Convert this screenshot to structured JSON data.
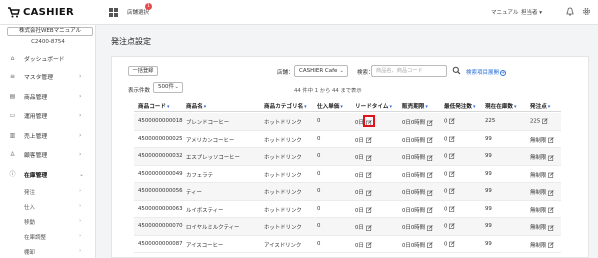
{
  "app": {
    "logo_text": "CASHIER",
    "brand_color": "#111111"
  },
  "header": {
    "store_switch_label": "店舗選択",
    "store_switch_badge": "1",
    "manual_label": "マニュアル",
    "user_label": "担当者",
    "user_chevron": "▾"
  },
  "sidebar": {
    "store_name": "株式会社WEBマニュアル",
    "store_code": "C2400-8754",
    "items": [
      {
        "label": "ダッシュボード",
        "icon": "home-icon"
      },
      {
        "label": "マスタ管理",
        "icon": "database-icon"
      },
      {
        "label": "商品管理",
        "icon": "box-icon"
      },
      {
        "label": "運用管理",
        "icon": "doc-icon"
      },
      {
        "label": "売上管理",
        "icon": "chart-icon"
      },
      {
        "label": "顧客管理",
        "icon": "person-icon"
      },
      {
        "label": "在庫管理",
        "icon": "info-icon"
      }
    ],
    "sub_items": [
      {
        "label": "発注"
      },
      {
        "label": "仕入"
      },
      {
        "label": "移動"
      },
      {
        "label": "在庫調整"
      },
      {
        "label": "棚卸"
      }
    ]
  },
  "main": {
    "title": "発注点設定",
    "add_button": "一括登録",
    "shop_label": "店舗：",
    "shop_value": "CASHIER Cafe",
    "keyword_label": "検索：",
    "keyword_placeholder": "商品名、商品コード",
    "advanced_search": "検索項目展開",
    "per_page_label": "表示件数",
    "per_page_value": "500件",
    "count_text": "44 件中 1 から 44 まで表示"
  },
  "table": {
    "headers": [
      "商品コード",
      "商品名",
      "商品カテゴリ名",
      "仕入単価",
      "リードタイム",
      "販売期限",
      "最低発注数",
      "現在在庫数",
      "発注点"
    ],
    "rows": [
      {
        "code": "4500000000018",
        "name": "ブレンドコーヒー",
        "category": "ホットドリンク",
        "cost": "0",
        "lead": "0日",
        "limit": "0日0時間",
        "min": "0",
        "stock": "225",
        "point": "225"
      },
      {
        "code": "4500000000025",
        "name": "アメリカンコーヒー",
        "category": "ホットドリンク",
        "cost": "0",
        "lead": "0日",
        "limit": "0日0時間",
        "min": "0",
        "stock": "99",
        "point": "無制限"
      },
      {
        "code": "4500000000032",
        "name": "エスプレッソコーヒー",
        "category": "ホットドリンク",
        "cost": "0",
        "lead": "0日",
        "limit": "0日0時間",
        "min": "0",
        "stock": "99",
        "point": "無制限"
      },
      {
        "code": "4500000000049",
        "name": "カフェラテ",
        "category": "ホットドリンク",
        "cost": "0",
        "lead": "0日",
        "limit": "0日0時間",
        "min": "0",
        "stock": "99",
        "point": "無制限"
      },
      {
        "code": "4500000000056",
        "name": "ティー",
        "category": "ホットドリンク",
        "cost": "0",
        "lead": "0日",
        "limit": "0日0時間",
        "min": "0",
        "stock": "99",
        "point": "無制限"
      },
      {
        "code": "4500000000063",
        "name": "ルイボスティー",
        "category": "ホットドリンク",
        "cost": "0",
        "lead": "0日",
        "limit": "0日0時間",
        "min": "0",
        "stock": "99",
        "point": "無制限"
      },
      {
        "code": "4500000000070",
        "name": "ロイヤルミルクティー",
        "category": "ホットドリンク",
        "cost": "0",
        "lead": "0日",
        "limit": "0日0時間",
        "min": "0",
        "stock": "99",
        "point": "無制限"
      },
      {
        "code": "4500000000087",
        "name": "アイスコーヒー",
        "category": "アイスドリンク",
        "cost": "0",
        "lead": "0日",
        "limit": "0日0時間",
        "min": "0",
        "stock": "99",
        "point": "無制限"
      }
    ]
  },
  "colors": {
    "accent": "#2e6fd8",
    "highlight": "#e0121d",
    "badge": "#e5484d"
  }
}
